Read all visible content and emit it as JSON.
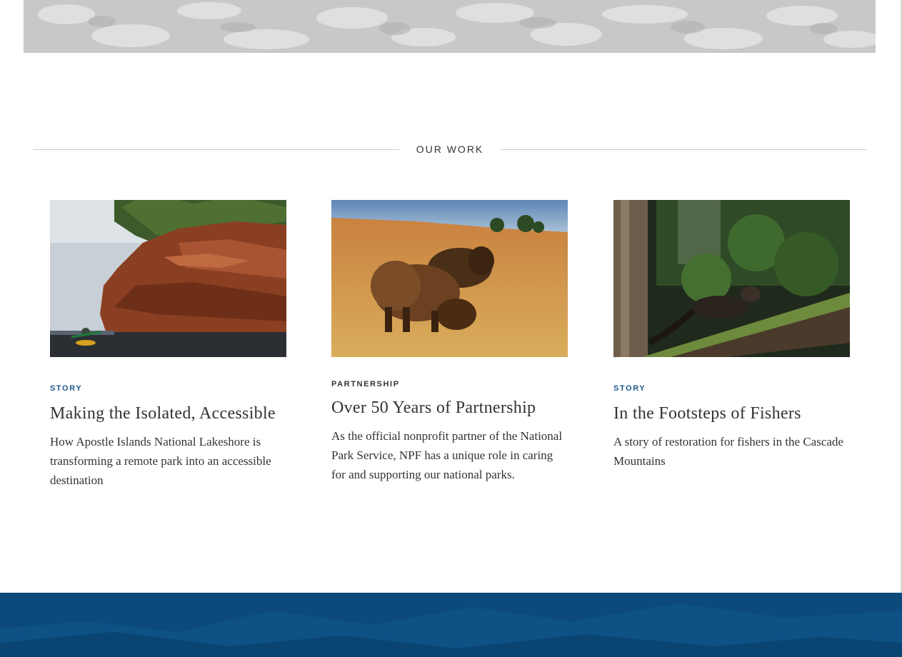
{
  "section": {
    "title": "OUR WORK"
  },
  "cards": [
    {
      "tag": "STORY",
      "title": "Making the Isolated, Accessible",
      "description": "How Apostle Islands National Lakeshore is transforming a remote park into an accessible destination",
      "image": "kayaker-by-sandstone-cliffs-photo"
    },
    {
      "tag": "PARTNERSHIP",
      "title": "Over 50 Years of Partnership",
      "description": "As the official nonprofit partner of the National Park Service, NPF has a unique role in caring for and supporting our national parks.",
      "image": "bison-grazing-in-prairie-photo"
    },
    {
      "tag": "STORY",
      "title": "In the Footsteps of Fishers",
      "description": "A story of restoration for fishers in the Cascade Mountains",
      "image": "fisher-on-mossy-log-photo"
    }
  ],
  "colors": {
    "accent_blue": "#1f5a8c",
    "footer_blue": "#0b4a7b",
    "text": "#333333",
    "rule": "#c9c9c9"
  }
}
